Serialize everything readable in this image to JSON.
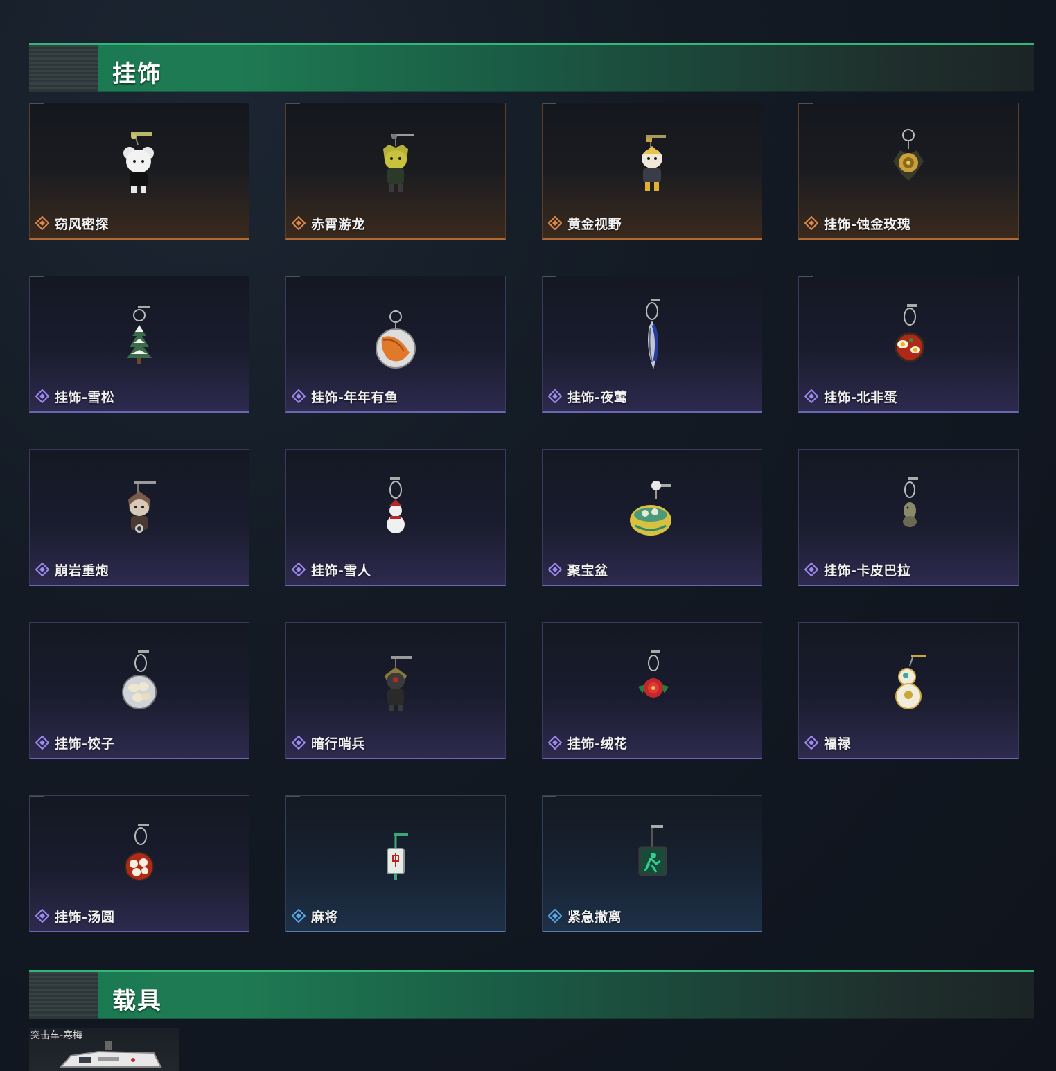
{
  "colors": {
    "accent_green": "#1c7a52",
    "tier_orange": "#e08a4a",
    "tier_purple": "#9f8bf0",
    "tier_blue": "#5aa7e8"
  },
  "sections": [
    {
      "title": "挂饰"
    },
    {
      "title": "载具"
    }
  ],
  "charms": [
    {
      "name": "窃风密探",
      "tier": "orange",
      "icon": "mouse-doll-charm-icon"
    },
    {
      "name": "赤霄游龙",
      "tier": "orange",
      "icon": "dragon-doll-charm-icon"
    },
    {
      "name": "黄金视野",
      "tier": "orange",
      "icon": "golden-doll-charm-icon"
    },
    {
      "name": "挂饰-蚀金玫瑰",
      "tier": "orange",
      "icon": "golden-rose-charm-icon"
    },
    {
      "name": "挂饰-雪松",
      "tier": "purple",
      "icon": "snow-pine-charm-icon"
    },
    {
      "name": "挂饰-年年有鱼",
      "tier": "purple",
      "icon": "fish-plate-charm-icon"
    },
    {
      "name": "挂饰-夜莺",
      "tier": "purple",
      "icon": "nightingale-feather-charm-icon"
    },
    {
      "name": "挂饰-北非蛋",
      "tier": "purple",
      "icon": "shakshuka-pan-charm-icon"
    },
    {
      "name": "崩岩重炮",
      "tier": "purple",
      "icon": "rock-cannon-doll-charm-icon"
    },
    {
      "name": "挂饰-雪人",
      "tier": "purple",
      "icon": "snowman-charm-icon"
    },
    {
      "name": "聚宝盆",
      "tier": "purple",
      "icon": "treasure-basin-charm-icon"
    },
    {
      "name": "挂饰-卡皮巴拉",
      "tier": "purple",
      "icon": "capybara-charm-icon"
    },
    {
      "name": "挂饰-饺子",
      "tier": "purple",
      "icon": "dumplings-plate-charm-icon"
    },
    {
      "name": "暗行哨兵",
      "tier": "purple",
      "icon": "shadow-sentry-doll-charm-icon"
    },
    {
      "name": "挂饰-绒花",
      "tier": "purple",
      "icon": "red-velvet-flower-charm-icon"
    },
    {
      "name": "福禄",
      "tier": "purple",
      "icon": "gourd-charm-icon"
    },
    {
      "name": "挂饰-汤圆",
      "tier": "purple",
      "icon": "tangyuan-bowl-charm-icon"
    },
    {
      "name": "麻将",
      "tier": "blue",
      "icon": "mahjong-tile-charm-icon"
    },
    {
      "name": "紧急撤离",
      "tier": "blue",
      "icon": "emergency-exit-sign-charm-icon"
    }
  ],
  "vehicles": [
    {
      "name": "突击车-寒梅",
      "icon": "assault-vehicle-icon"
    }
  ]
}
